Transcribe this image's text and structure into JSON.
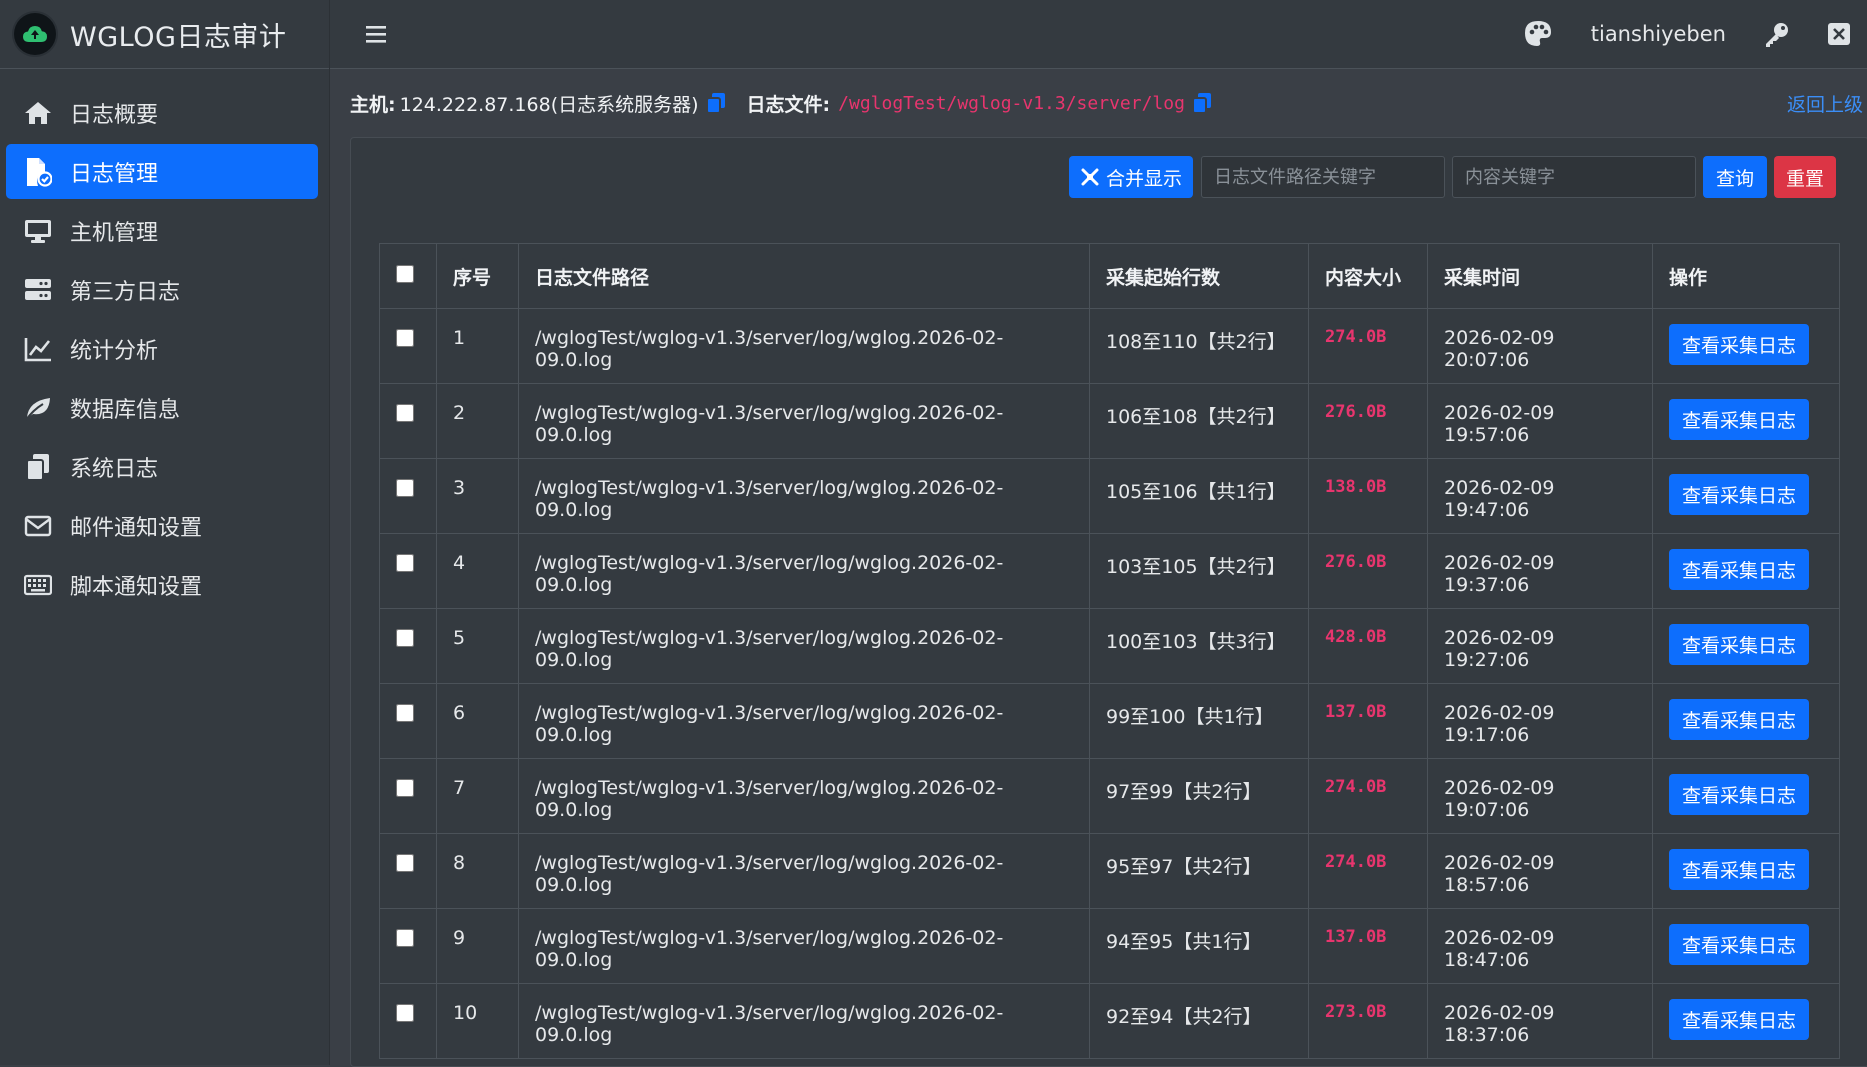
{
  "app": {
    "title": "WGLOG日志审计"
  },
  "sidebar": {
    "items": [
      {
        "label": "日志概要",
        "icon": "home-icon",
        "active": false
      },
      {
        "label": "日志管理",
        "icon": "file-check-icon",
        "active": true
      },
      {
        "label": "主机管理",
        "icon": "desktop-icon",
        "active": false
      },
      {
        "label": "第三方日志",
        "icon": "server-icon",
        "active": false
      },
      {
        "label": "统计分析",
        "icon": "line-chart-icon",
        "active": false
      },
      {
        "label": "数据库信息",
        "icon": "leaf-icon",
        "active": false
      },
      {
        "label": "系统日志",
        "icon": "copy-files-icon",
        "active": false
      },
      {
        "label": "邮件通知设置",
        "icon": "envelope-icon",
        "active": false
      },
      {
        "label": "脚本通知设置",
        "icon": "keyboard-icon",
        "active": false
      }
    ]
  },
  "topbar": {
    "username": "tianshiyeben"
  },
  "info": {
    "host_label": "主机:",
    "host_value": "124.222.87.168(日志系统服务器)",
    "file_label": "日志文件:",
    "file_path": "/wglogTest/wglog-v1.3/server/log",
    "back_link": "返回上级"
  },
  "filter": {
    "merge_label": "合并显示",
    "path_placeholder": "日志文件路径关键字",
    "content_placeholder": "内容关键字",
    "query_label": "查询",
    "reset_label": "重置"
  },
  "table": {
    "headers": [
      "序号",
      "日志文件路径",
      "采集起始行数",
      "内容大小",
      "采集时间",
      "操作"
    ],
    "action_label": "查看采集日志",
    "rows": [
      {
        "index": "1",
        "path": "/wglogTest/wglog-v1.3/server/log/wglog.2026-02-09.0.log",
        "lines": "108至110【共2行】",
        "size": "274.0B",
        "time": "2026-02-09 20:07:06"
      },
      {
        "index": "2",
        "path": "/wglogTest/wglog-v1.3/server/log/wglog.2026-02-09.0.log",
        "lines": "106至108【共2行】",
        "size": "276.0B",
        "time": "2026-02-09 19:57:06"
      },
      {
        "index": "3",
        "path": "/wglogTest/wglog-v1.3/server/log/wglog.2026-02-09.0.log",
        "lines": "105至106【共1行】",
        "size": "138.0B",
        "time": "2026-02-09 19:47:06"
      },
      {
        "index": "4",
        "path": "/wglogTest/wglog-v1.3/server/log/wglog.2026-02-09.0.log",
        "lines": "103至105【共2行】",
        "size": "276.0B",
        "time": "2026-02-09 19:37:06"
      },
      {
        "index": "5",
        "path": "/wglogTest/wglog-v1.3/server/log/wglog.2026-02-09.0.log",
        "lines": "100至103【共3行】",
        "size": "428.0B",
        "time": "2026-02-09 19:27:06"
      },
      {
        "index": "6",
        "path": "/wglogTest/wglog-v1.3/server/log/wglog.2026-02-09.0.log",
        "lines": "99至100【共1行】",
        "size": "137.0B",
        "time": "2026-02-09 19:17:06"
      },
      {
        "index": "7",
        "path": "/wglogTest/wglog-v1.3/server/log/wglog.2026-02-09.0.log",
        "lines": "97至99【共2行】",
        "size": "274.0B",
        "time": "2026-02-09 19:07:06"
      },
      {
        "index": "8",
        "path": "/wglogTest/wglog-v1.3/server/log/wglog.2026-02-09.0.log",
        "lines": "95至97【共2行】",
        "size": "274.0B",
        "time": "2026-02-09 18:57:06"
      },
      {
        "index": "9",
        "path": "/wglogTest/wglog-v1.3/server/log/wglog.2026-02-09.0.log",
        "lines": "94至95【共1行】",
        "size": "137.0B",
        "time": "2026-02-09 18:47:06"
      },
      {
        "index": "10",
        "path": "/wglogTest/wglog-v1.3/server/log/wglog.2026-02-09.0.log",
        "lines": "92至94【共2行】",
        "size": "273.0B",
        "time": "2026-02-09 18:37:06"
      }
    ]
  },
  "colors": {
    "primary": "#0d6efd",
    "danger": "#dc3545",
    "size_text": "#e8356e",
    "background": "#3a3f46",
    "panel": "#343a40"
  }
}
